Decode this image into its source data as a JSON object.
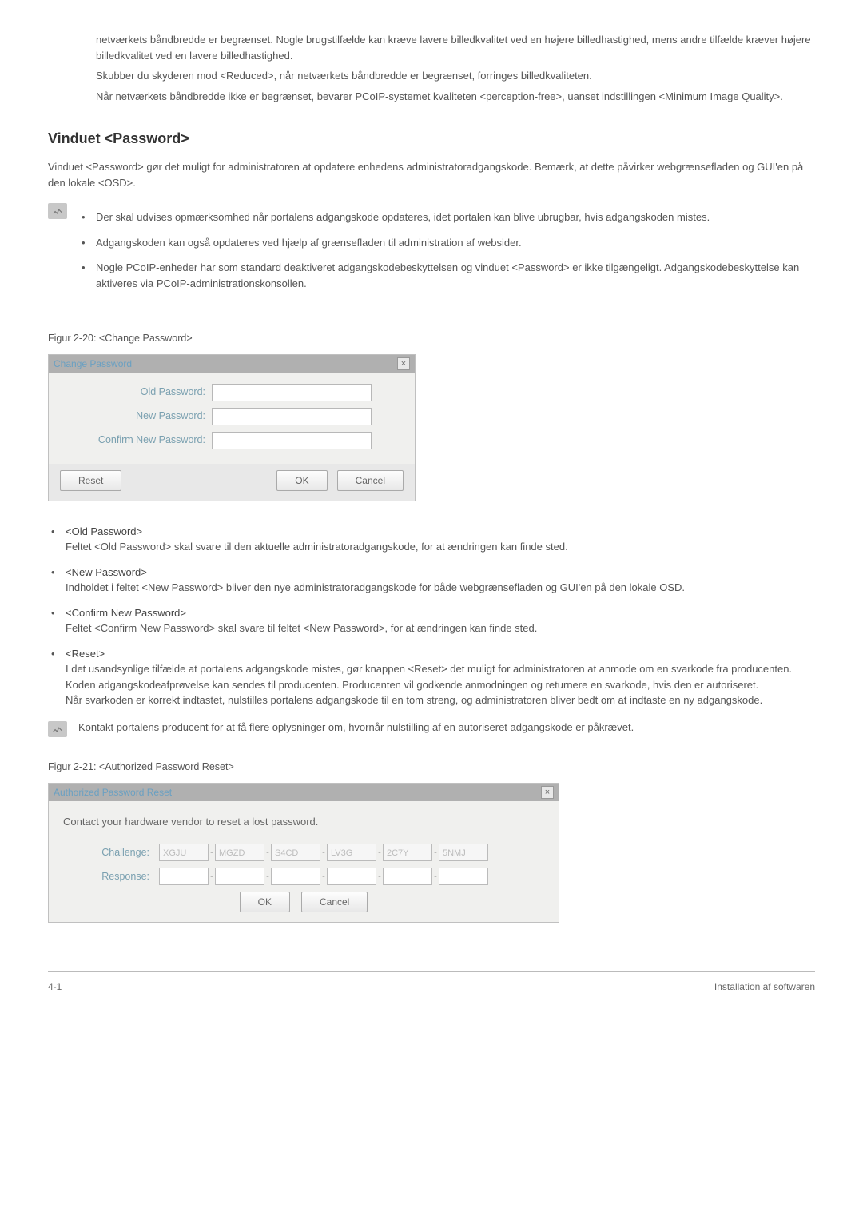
{
  "intro": {
    "p1": "netværkets båndbredde er begrænset. Nogle brugstilfælde kan kræve lavere billedkvalitet ved en højere billedhastighed, mens andre tilfælde kræver højere billedkvalitet ved en lavere billedhastighed.",
    "p2": "Skubber du skyderen mod <Reduced>, når netværkets båndbredde er begrænset, forringes billedkvaliteten.",
    "p3": "Når netværkets båndbredde ikke er begrænset, bevarer PCoIP-systemet kvaliteten <perception-free>, uanset indstillingen <Minimum Image Quality>."
  },
  "heading": "Vinduet <Password>",
  "heading_para": "Vinduet <Password> gør det muligt for administratoren at opdatere enhedens administratoradgangskode. Bemærk, at dette påvirker webgrænsefladen og GUI'en på den lokale <OSD>.",
  "note_bullets": [
    "Der skal udvises opmærksomhed når portalens adgangskode opdateres, idet portalen kan blive ubrugbar, hvis adgangskoden mistes.",
    "Adgangskoden kan også opdateres ved hjælp af grænsefladen til administration af websider.",
    "Nogle PCoIP-enheder har som standard deaktiveret adgangskodebeskyttelsen og vinduet <Password> er ikke tilgængeligt. Adgangskodebeskyttelse kan aktiveres via PCoIP-administrationskonsollen."
  ],
  "fig1_caption": "Figur 2-20: <Change Password>",
  "change_password_dialog": {
    "title": "Change Password",
    "old_label": "Old Password:",
    "new_label": "New Password:",
    "confirm_label": "Confirm New Password:",
    "reset_btn": "Reset",
    "ok_btn": "OK",
    "cancel_btn": "Cancel"
  },
  "field_terms": [
    {
      "term": "<Old Password>",
      "desc": "Feltet <Old Password> skal svare til den aktuelle administratoradgangskode, for at ændringen kan finde sted."
    },
    {
      "term": "<New Password>",
      "desc": "Indholdet i feltet <New Password> bliver den nye administratoradgangskode for både webgrænsefladen og GUI'en på den lokale OSD."
    },
    {
      "term": "<Confirm New Password>",
      "desc": "Feltet <Confirm New Password> skal svare til feltet <New Password>, for at ændringen kan finde sted."
    },
    {
      "term": "<Reset>",
      "desc": "I det usandsynlige tilfælde at portalens adgangskode mistes, gør knappen <Reset> det muligt for administratoren at anmode om en svarkode fra producenten. Koden adgangskodeafprøvelse kan sendes til producenten. Producenten vil godkende anmodningen og returnere en svarkode, hvis den er autoriseret.",
      "desc2": "Når svarkoden er korrekt indtastet, nulstilles portalens adgangskode til en tom streng, og administratoren bliver bedt om at indtaste en ny adgangskode."
    }
  ],
  "note2": "Kontakt portalens producent for at få flere oplysninger om, hvornår nulstilling af en autoriseret adgangskode er påkrævet.",
  "fig2_caption": "Figur 2-21: <Authorized Password Reset>",
  "apr_dialog": {
    "title": "Authorized Password Reset",
    "message": "Contact your hardware vendor to reset a lost password.",
    "challenge_label": "Challenge:",
    "response_label": "Response:",
    "challenge_values": [
      "XGJU",
      "MGZD",
      "S4CD",
      "LV3G",
      "2C7Y",
      "5NMJ"
    ],
    "ok_btn": "OK",
    "cancel_btn": "Cancel"
  },
  "footer": {
    "left": "4-1",
    "right": "Installation af softwaren"
  }
}
